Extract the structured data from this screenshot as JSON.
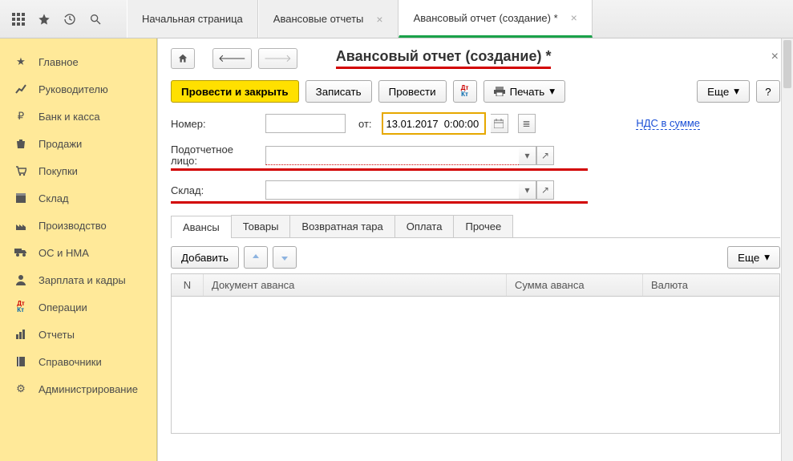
{
  "top_tabs": [
    {
      "label": "Начальная страница",
      "closable": false
    },
    {
      "label": "Авансовые отчеты",
      "closable": true
    },
    {
      "label": "Авансовый отчет (создание) *",
      "closable": true,
      "active": true
    }
  ],
  "sidebar": {
    "items": [
      {
        "icon": "star",
        "label": "Главное"
      },
      {
        "icon": "chart",
        "label": "Руководителю"
      },
      {
        "icon": "ruble",
        "label": "Банк и касса"
      },
      {
        "icon": "bag",
        "label": "Продажи"
      },
      {
        "icon": "cart",
        "label": "Покупки"
      },
      {
        "icon": "box",
        "label": "Склад"
      },
      {
        "icon": "factory",
        "label": "Производство"
      },
      {
        "icon": "truck",
        "label": "ОС и НМА"
      },
      {
        "icon": "person",
        "label": "Зарплата и кадры"
      },
      {
        "icon": "dtkt",
        "label": "Операции"
      },
      {
        "icon": "bars",
        "label": "Отчеты"
      },
      {
        "icon": "book",
        "label": "Справочники"
      },
      {
        "icon": "gear",
        "label": "Администрирование"
      }
    ]
  },
  "page_title": "Авансовый отчет (создание) *",
  "toolbar": {
    "post_close": "Провести и закрыть",
    "save": "Записать",
    "post": "Провести",
    "print": "Печать",
    "more": "Еще"
  },
  "form": {
    "number_label": "Номер:",
    "number_value": "",
    "from_label": "от:",
    "date_value": "13.01.2017  0:00:00",
    "vat_link": "НДС в сумме",
    "person_label": "Подотчетное лицо:",
    "person_value": "",
    "warehouse_label": "Склад:",
    "warehouse_value": ""
  },
  "subtabs": [
    "Авансы",
    "Товары",
    "Возвратная тара",
    "Оплата",
    "Прочее"
  ],
  "grid": {
    "add": "Добавить",
    "more": "Еще",
    "cols": {
      "n": "N",
      "doc": "Документ аванса",
      "sum": "Сумма аванса",
      "cur": "Валюта"
    }
  }
}
